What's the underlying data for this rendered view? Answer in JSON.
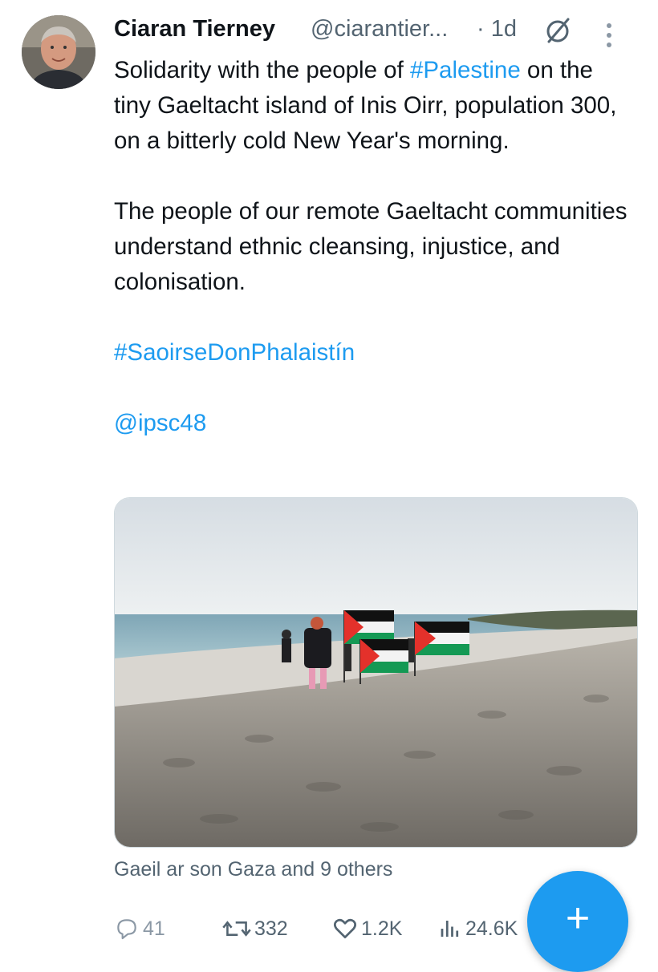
{
  "tweet": {
    "author_name": "Ciaran Tierney",
    "author_handle": "@ciarantier...",
    "time": "· 1d",
    "paragraph_1_pre": "Solidarity with the people of ",
    "paragraph_1_hashtag": "#Palestine",
    "paragraph_1_post": " on the tiny Gaeltacht island of Inis Oirr, population 300, on a bitterly cold New Year's morning.",
    "paragraph_2": "The people of our remote Gaeltacht communities understand ethnic cleansing, injustice, and colonisation.",
    "hashtag_2": "#SaoirseDonPhalaistín",
    "mention": "@ipsc48",
    "social_context": "Gaeil ar son Gaza and 9 others"
  },
  "actions": {
    "reply_count": "41",
    "repost_count": "332",
    "like_count": "1.2K",
    "view_count": "24.6K"
  },
  "fab": {
    "label": "+"
  },
  "colors": {
    "accent": "#1d9bf0",
    "text": "#0f1419",
    "muted": "#536471",
    "flag_green": "#149954",
    "flag_red": "#e4312b"
  },
  "icons": [
    "grok-icon",
    "more-vertical-icon",
    "reply-icon",
    "repost-icon",
    "like-icon",
    "views-icon"
  ]
}
